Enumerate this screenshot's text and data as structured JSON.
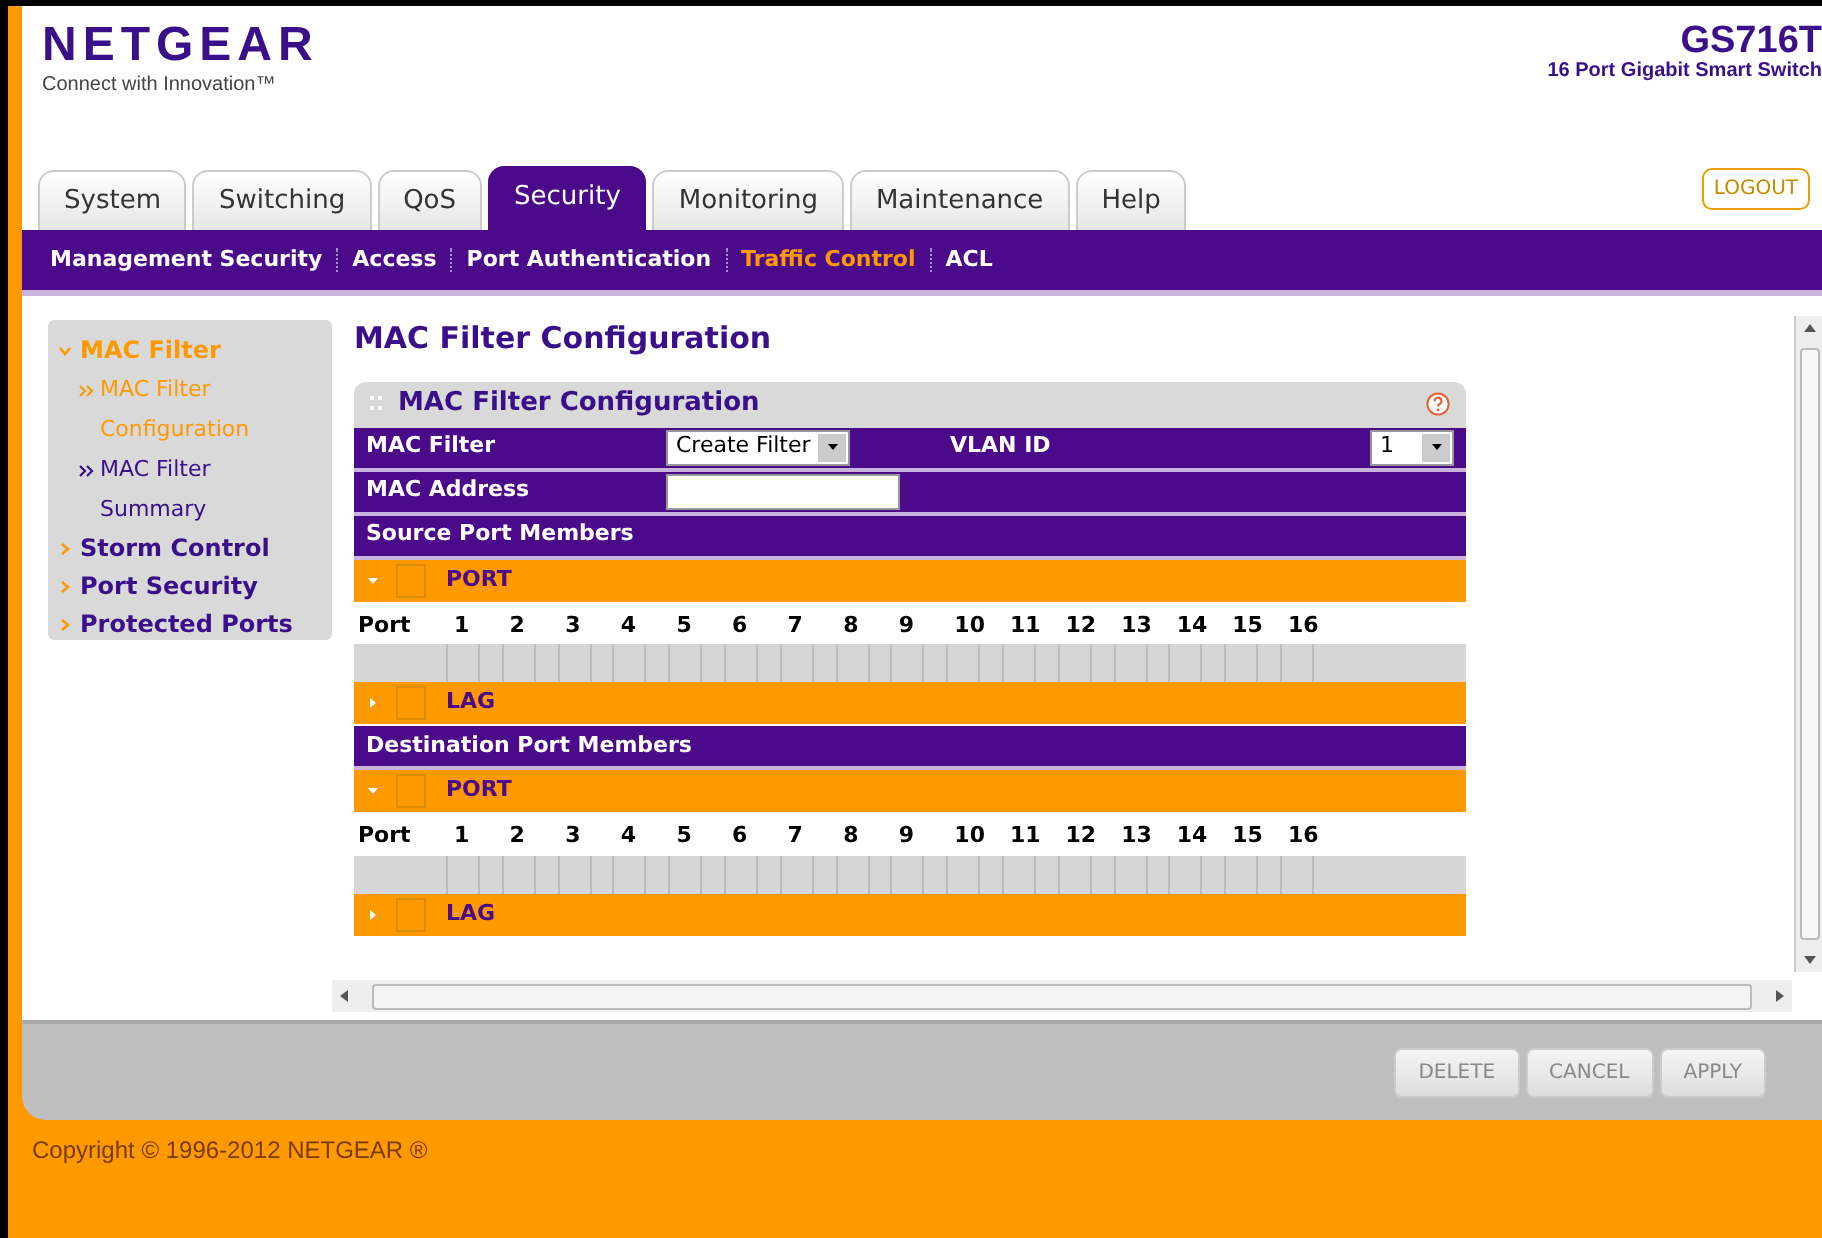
{
  "header": {
    "logo": "NETGEAR",
    "tagline": "Connect with Innovation™",
    "model": "GS716T",
    "model_subtitle": "16 Port Gigabit Smart Switch",
    "logout": "LOGOUT"
  },
  "tabs": [
    {
      "label": "System",
      "selected": false
    },
    {
      "label": "Switching",
      "selected": false
    },
    {
      "label": "QoS",
      "selected": false
    },
    {
      "label": "Security",
      "selected": true
    },
    {
      "label": "Monitoring",
      "selected": false
    },
    {
      "label": "Maintenance",
      "selected": false
    },
    {
      "label": "Help",
      "selected": false
    }
  ],
  "subtabs": [
    {
      "label": "Management Security",
      "selected": false
    },
    {
      "label": "Access",
      "selected": false
    },
    {
      "label": "Port Authentication",
      "selected": false
    },
    {
      "label": "Traffic Control",
      "selected": true
    },
    {
      "label": "ACL",
      "selected": false
    }
  ],
  "sidebar": {
    "items": [
      {
        "label": "MAC Filter",
        "selected": true,
        "expanded": true,
        "children": [
          {
            "label": "MAC Filter Configuration",
            "selected": true
          },
          {
            "label": "MAC Filter Summary",
            "selected": false
          }
        ]
      },
      {
        "label": "Storm Control",
        "selected": false,
        "expanded": false
      },
      {
        "label": "Port Security",
        "selected": false,
        "expanded": false
      },
      {
        "label": "Protected Ports",
        "selected": false,
        "expanded": false
      }
    ]
  },
  "page_title": "MAC Filter Configuration",
  "panel": {
    "title": "MAC Filter Configuration",
    "mac_filter": {
      "label": "MAC Filter",
      "value": "Create Filter"
    },
    "vlan_id": {
      "label": "VLAN ID",
      "value": "1"
    },
    "mac_address": {
      "label": "MAC Address"
    },
    "sections": [
      {
        "title": "Source Port Members",
        "groups": [
          {
            "label": "PORT",
            "expanded": true,
            "checked": false,
            "header": "Port",
            "ports": [
              {
                "label": "1",
                "checked": false
              },
              {
                "label": "2",
                "checked": false
              },
              {
                "label": "3",
                "checked": false
              },
              {
                "label": "4",
                "checked": false
              },
              {
                "label": "5",
                "checked": false
              },
              {
                "label": "6",
                "checked": false
              },
              {
                "label": "7",
                "checked": false
              },
              {
                "label": "8",
                "checked": false
              },
              {
                "label": "9",
                "checked": false
              },
              {
                "label": "10",
                "checked": false
              },
              {
                "label": "11",
                "checked": false
              },
              {
                "label": "12",
                "checked": false
              },
              {
                "label": "13",
                "checked": false
              },
              {
                "label": "14",
                "checked": false
              },
              {
                "label": "15",
                "checked": false
              },
              {
                "label": "16",
                "checked": false
              }
            ]
          },
          {
            "label": "LAG",
            "expanded": false,
            "checked": false
          }
        ]
      },
      {
        "title": "Destination Port Members",
        "groups": [
          {
            "label": "PORT",
            "expanded": true,
            "checked": false,
            "header": "Port",
            "ports": [
              {
                "label": "1",
                "checked": false
              },
              {
                "label": "2",
                "checked": false
              },
              {
                "label": "3",
                "checked": false
              },
              {
                "label": "4",
                "checked": false
              },
              {
                "label": "5",
                "checked": false
              },
              {
                "label": "6",
                "checked": false
              },
              {
                "label": "7",
                "checked": false
              },
              {
                "label": "8",
                "checked": false
              },
              {
                "label": "9",
                "checked": false
              },
              {
                "label": "10",
                "checked": false
              },
              {
                "label": "11",
                "checked": false
              },
              {
                "label": "12",
                "checked": false
              },
              {
                "label": "13",
                "checked": false
              },
              {
                "label": "14",
                "checked": false
              },
              {
                "label": "15",
                "checked": false
              },
              {
                "label": "16",
                "checked": false
              }
            ]
          },
          {
            "label": "LAG",
            "expanded": false,
            "checked": false
          }
        ]
      }
    ]
  },
  "buttons": [
    "DELETE",
    "CANCEL",
    "APPLY"
  ],
  "copyright": "Copyright © 1996-2012 NETGEAR ®"
}
